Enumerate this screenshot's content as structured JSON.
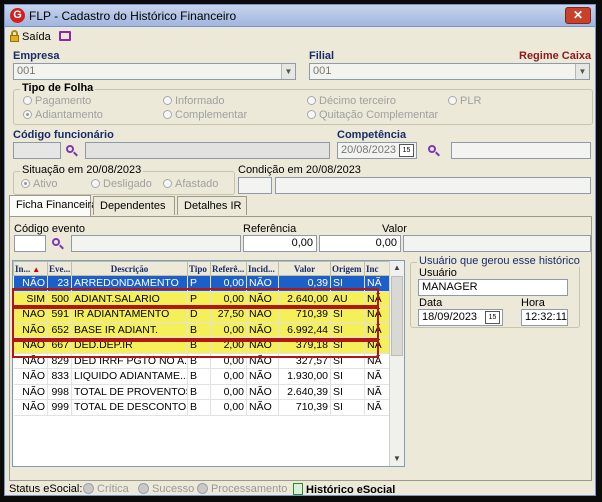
{
  "window": {
    "title": "FLP - Cadastro do Histórico Financeiro",
    "close": "✕"
  },
  "toolbar": {
    "saida_label": "Saída"
  },
  "empresa": {
    "label": "Empresa",
    "value": "001"
  },
  "filial": {
    "label": "Filial",
    "value": "001"
  },
  "regime": {
    "label": "Regime Caixa"
  },
  "tipo_folha": {
    "title": "Tipo de Folha",
    "options": [
      "Pagamento",
      "Informado",
      "Décimo terceiro",
      "PLR",
      "Adiantamento",
      "Complementar",
      "Quitação Complementar"
    ],
    "selected": "Adiantamento"
  },
  "funcionario": {
    "label": "Código funcionário"
  },
  "competencia": {
    "label": "Competência",
    "value": "20/08/2023"
  },
  "situacao": {
    "title": "Situação em 20/08/2023",
    "options": [
      "Ativo",
      "Desligado",
      "Afastado"
    ],
    "selected": "Ativo"
  },
  "condicao": {
    "title": "Condição em 20/08/2023"
  },
  "tabs": [
    "Ficha Financeira",
    "Dependentes",
    "Detalhes IR"
  ],
  "evento": {
    "label": "Código evento"
  },
  "referencia": {
    "label": "Referência",
    "value": "0,00"
  },
  "valor": {
    "label": "Valor",
    "value": "0,00"
  },
  "grid": {
    "columns": [
      "In...",
      "Eve...",
      "Descrição",
      "Tipo",
      "Referê...",
      "Incid...",
      "Valor",
      "Origem",
      "Inc"
    ],
    "rows": [
      [
        "NÃO",
        "23",
        "ARREDONDAMENTO",
        "P",
        "0,00",
        "NÃO",
        "0,39",
        "SI",
        "NÃ"
      ],
      [
        "SIM",
        "500",
        "ADIANT.SALARIO",
        "P",
        "0,00",
        "NÃO",
        "2.640,00",
        "AU",
        "NÃ"
      ],
      [
        "NÃO",
        "591",
        "IR ADIANTAMENTO",
        "D",
        "27,50",
        "NÃO",
        "710,39",
        "SI",
        "NÃ"
      ],
      [
        "NÃO",
        "652",
        "BASE IR ADIANT.",
        "B",
        "0,00",
        "NÃO",
        "6.992,44",
        "SI",
        "NÃ"
      ],
      [
        "NÃO",
        "667",
        "DED.DEP.IR",
        "B",
        "2,00",
        "NÃO",
        "379,18",
        "SI",
        "NÃ"
      ],
      [
        "NÃO",
        "829",
        "DED IRRF PGTO NO A...",
        "B",
        "0,00",
        "NÃO",
        "327,57",
        "SI",
        "NÃ"
      ],
      [
        "NÃO",
        "833",
        "LIQUIDO ADIANTAME...",
        "B",
        "0,00",
        "NÃO",
        "1.930,00",
        "SI",
        "NÃ"
      ],
      [
        "NÃO",
        "998",
        "TOTAL DE PROVENTOS",
        "B",
        "0,00",
        "NÃO",
        "2.640,39",
        "SI",
        "NÃ"
      ],
      [
        "NÃO",
        "999",
        "TOTAL DE DESCONTOS",
        "B",
        "0,00",
        "NÃO",
        "710,39",
        "SI",
        "NÃ"
      ]
    ]
  },
  "usuario_box": {
    "title": "Usuário que gerou esse histórico",
    "usuario_label": "Usuário",
    "usuario_value": "MANAGER",
    "data_label": "Data",
    "data_value": "18/09/2023",
    "hora_label": "Hora",
    "hora_value": "12:32:11"
  },
  "statusbar": {
    "label": "Status eSocial:",
    "critica": "Crítica",
    "sucesso": "Sucesso",
    "processamento": "Processamento",
    "historico": "Histórico eSocial"
  },
  "colors": {
    "highlight": "#f5f05a",
    "selected": "#1b5fc9",
    "annotation": "#b01818"
  }
}
